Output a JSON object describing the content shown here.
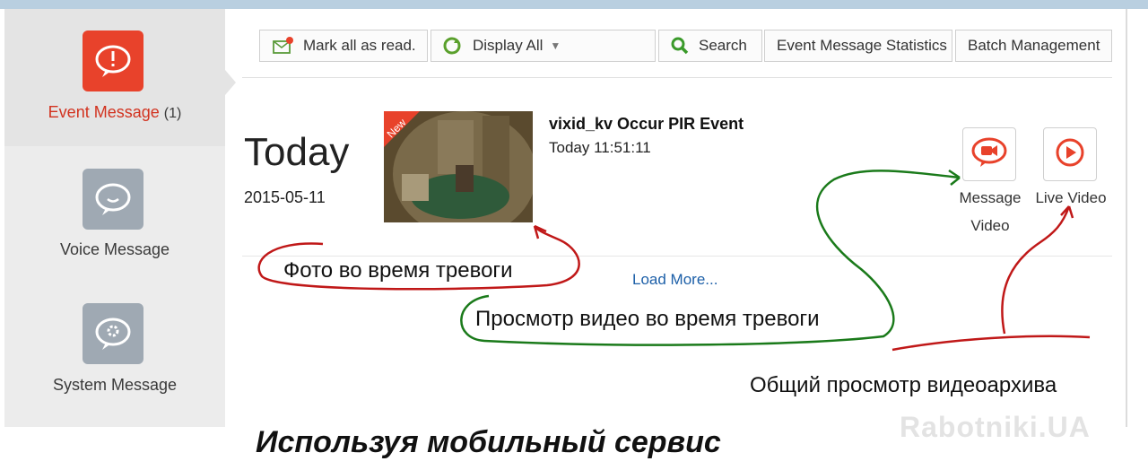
{
  "sidebar": {
    "items": [
      {
        "label": "Event Message",
        "count": "(1)",
        "icon": "alert-bubble-icon"
      },
      {
        "label": "Voice Message",
        "icon": "voice-bubble-icon"
      },
      {
        "label": "System Message",
        "icon": "gear-bubble-icon"
      }
    ]
  },
  "toolbar": {
    "mark_all": "Mark all as read.",
    "display": "Display All",
    "search": "Search",
    "statistics": "Event Message Statistics",
    "batch": "Batch Management"
  },
  "event_group": {
    "heading": "Today",
    "date": "2015-05-11"
  },
  "event": {
    "badge": "New",
    "title": "vixid_kv Occur PIR Event",
    "time": "Today 11:51:11",
    "message_video_label_1": "Message",
    "message_video_label_2": "Video",
    "live_video_label": "Live Video"
  },
  "load_more": "Load More...",
  "annotations": {
    "photo": "Фото во время тревоги",
    "video": "Просмотр видео во время тревоги",
    "archive": "Общий просмотр видеоархива",
    "bottom": "Используя мобильный сервис"
  },
  "watermark": "Rabotniki.UA",
  "colors": {
    "accent_red": "#e8422b",
    "annotation_red": "#c01818",
    "annotation_green": "#1a7a1a",
    "link_blue": "#1c5fa8"
  }
}
